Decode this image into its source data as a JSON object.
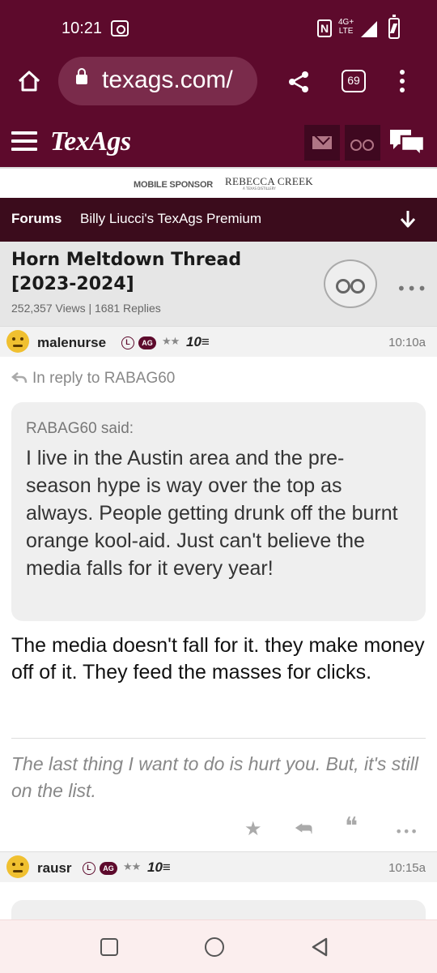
{
  "status_bar": {
    "time": "10:21",
    "nfc": "N",
    "network_top": "4G+",
    "network_bottom": "LTE"
  },
  "browser": {
    "url": "texags.com/",
    "tab_count": "69"
  },
  "site": {
    "logo": "TexAgs"
  },
  "sponsor": {
    "label": "MOBILE SPONSOR",
    "logo": "REBECCA CREEK",
    "sub": "A TEXAS DISTILLERY"
  },
  "forum_nav": {
    "forums": "Forums",
    "premium": "Billy Liucci's TexAgs Premium"
  },
  "thread": {
    "title": "Horn Meltdown Thread [2023-2024]",
    "stats": "252,357 Views | 1681 Replies"
  },
  "posts": [
    {
      "username": "malenurse",
      "badge_l": "L",
      "badge_ag": "AG",
      "stars": "★★",
      "rank": "10≡",
      "time": "10:10a",
      "reply_to": "In reply to RABAG60",
      "quote_author": "RABAG60 said:",
      "quote_text": "I live in the Austin area and the pre-season hype is way over the top as always. People getting drunk off the burnt orange kool-aid. Just can't believe the media falls for it every year!",
      "text": "The media doesn't fall for it. they make money off of it. They feed the masses for clicks.",
      "signature": "The last thing I want to do is hurt you. But, it's still on the list."
    },
    {
      "username": "rausr",
      "badge_l": "L",
      "badge_ag": "AG",
      "stars": "★★",
      "rank": "10≡",
      "time": "10:15a"
    }
  ],
  "actions": {
    "star": "★",
    "reply": "⮪",
    "quote": "❝",
    "more": "•••"
  },
  "icons": [
    "home-icon",
    "lock-icon",
    "share-icon",
    "tabs-icon",
    "hamburger-icon",
    "mail-icon",
    "binoculars-icon",
    "chat-icon",
    "down-arrow-icon",
    "reply-icon"
  ],
  "colors": {
    "brand": "#5d0a2c",
    "nav_dark": "#3b0c1c"
  }
}
